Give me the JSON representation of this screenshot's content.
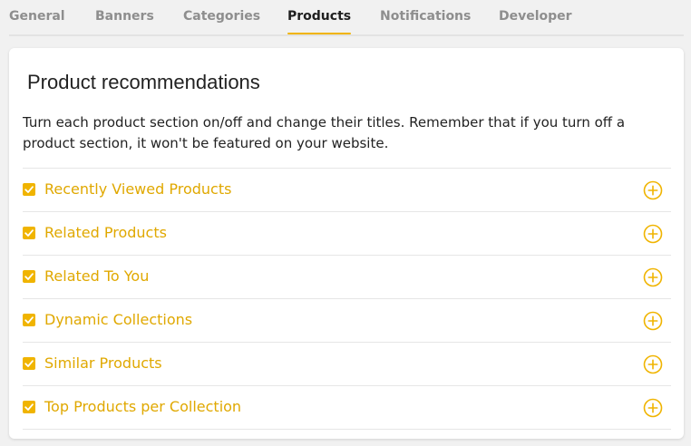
{
  "tabs": [
    {
      "label": "General",
      "active": false
    },
    {
      "label": "Banners",
      "active": false
    },
    {
      "label": "Categories",
      "active": false
    },
    {
      "label": "Products",
      "active": true
    },
    {
      "label": "Notifications",
      "active": false
    },
    {
      "label": "Developer",
      "active": false
    }
  ],
  "card": {
    "title": "Product recommendations",
    "description": "Turn each product section on/off and change their titles. Remember that if you turn off a product section, it won't be featured on your website."
  },
  "sections": [
    {
      "label": "Recently Viewed Products",
      "checked": true
    },
    {
      "label": "Related Products",
      "checked": true
    },
    {
      "label": "Related To You",
      "checked": true
    },
    {
      "label": "Dynamic Collections",
      "checked": true
    },
    {
      "label": "Similar Products",
      "checked": true
    },
    {
      "label": "Top Products per Collection",
      "checked": true
    }
  ],
  "icons": {
    "checkbox": "check-icon",
    "expand": "plus-circle-icon"
  },
  "colors": {
    "accent": "#f0b400",
    "label": "#e0a800",
    "background": "#f1f1f1"
  }
}
